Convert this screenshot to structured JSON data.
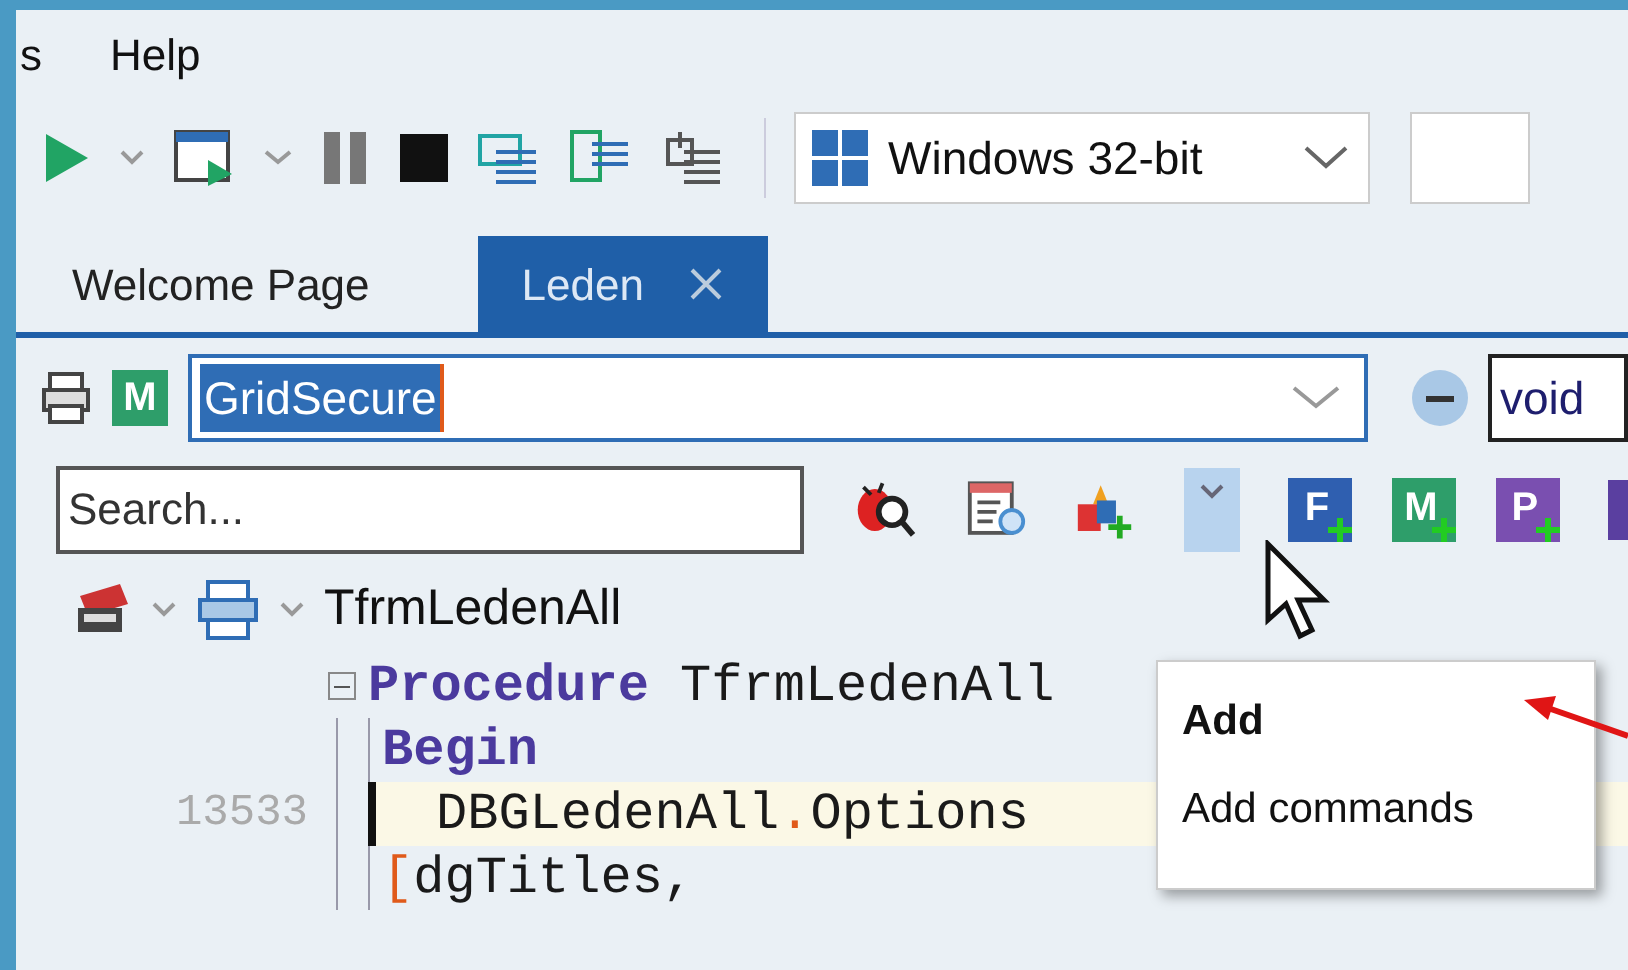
{
  "menu": [
    {
      "label": "s"
    },
    {
      "label": "Help"
    }
  ],
  "toolbar": {
    "platform": "Windows 32-bit"
  },
  "tabs": [
    {
      "label": "Welcome Page",
      "selected": false,
      "closable": false
    },
    {
      "label": "Leden",
      "selected": true,
      "closable": true
    }
  ],
  "unit_combo": {
    "value": "GridSecure"
  },
  "method_field": {
    "value": "void"
  },
  "search": {
    "placeholder": "Search..."
  },
  "class_name": "TfrmLedenAll",
  "module_badge": "M",
  "add_buttons": [
    {
      "letter": "F",
      "color": "#2f5fb0"
    },
    {
      "letter": "M",
      "color": "#2e9e6a"
    },
    {
      "letter": "P",
      "color": "#7a4fb0"
    }
  ],
  "code": [
    {
      "fold": true,
      "segments": [
        {
          "text": "Procedure",
          "kind": "keyword"
        },
        {
          "text": " TfrmLedenAll",
          "kind": "ident"
        }
      ]
    },
    {
      "fold": false,
      "segments": [
        {
          "text": "Begin",
          "kind": "keyword"
        }
      ]
    },
    {
      "gutter": "13533",
      "fold": false,
      "current": true,
      "segments": [
        {
          "text": "DBGLedenAll",
          "kind": "ident"
        },
        {
          "text": ".",
          "kind": "punct"
        },
        {
          "text": "Options",
          "kind": "ident"
        }
      ]
    },
    {
      "fold": false,
      "segments": [
        {
          "text": "[",
          "kind": "punct"
        },
        {
          "text": "dgTitles,",
          "kind": "ident"
        }
      ]
    }
  ],
  "popup_menu": [
    {
      "label": "Add",
      "kind": "header"
    },
    {
      "label": "Add commands",
      "kind": "item"
    }
  ]
}
